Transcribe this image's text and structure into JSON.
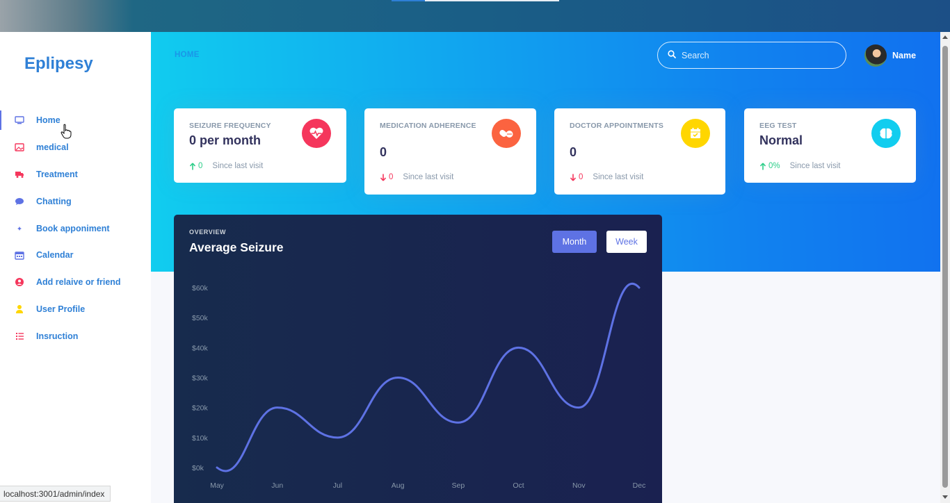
{
  "sidebar": {
    "brand": "Eplipesy",
    "items": [
      {
        "label": "Home",
        "icon": "monitor-icon",
        "color": "#5e72e4"
      },
      {
        "label": "medical",
        "icon": "image-icon",
        "color": "#f5365c"
      },
      {
        "label": "Treatment",
        "icon": "truck-icon",
        "color": "#f5365c"
      },
      {
        "label": "Chatting",
        "icon": "chat-bubble-icon",
        "color": "#5e72e4"
      },
      {
        "label": "Book apponiment",
        "icon": "sparkle-icon",
        "color": "#5e72e4"
      },
      {
        "label": "Calendar",
        "icon": "calendar-icon",
        "color": "#5e72e4"
      },
      {
        "label": "Add relaive or friend",
        "icon": "user-circle-icon",
        "color": "#f5365c"
      },
      {
        "label": "User Profile",
        "icon": "user-icon",
        "color": "#ffd600"
      },
      {
        "label": "Insruction",
        "icon": "list-icon",
        "color": "#f5365c"
      }
    ]
  },
  "header": {
    "breadcrumb": "HOME",
    "search_placeholder": "Search",
    "user_name": "Name"
  },
  "cards": [
    {
      "title": "Seizure frequency",
      "value": "0 per month",
      "delta": "0",
      "direction": "up",
      "since": "Since last visit",
      "icon": "heart-pulse-icon",
      "icon_color": "#f5365c"
    },
    {
      "title": "Medication adherence",
      "value": "0",
      "delta": "0",
      "direction": "down",
      "since": "Since last visit",
      "icon": "pills-icon",
      "icon_color": "#fb6340"
    },
    {
      "title": "Doctor appointments",
      "value": "0",
      "delta": "0",
      "direction": "down",
      "since": "Since last visit",
      "icon": "calendar-check-icon",
      "icon_color": "#ffd600"
    },
    {
      "title": "EEG test",
      "value": "Normal",
      "delta": "0%",
      "direction": "up",
      "since": "Since last visit",
      "icon": "brain-icon",
      "icon_color": "#11cdef"
    }
  ],
  "overview": {
    "label": "OVERVIEW",
    "title": "Average Seizure",
    "tab_month": "Month",
    "tab_week": "Week"
  },
  "chart_data": {
    "type": "line",
    "categories": [
      "May",
      "Jun",
      "Jul",
      "Aug",
      "Sep",
      "Oct",
      "Nov",
      "Dec"
    ],
    "values": [
      0,
      20,
      10,
      30,
      15,
      40,
      20,
      60
    ],
    "yticks": [
      "$0k",
      "$10k",
      "$20k",
      "$30k",
      "$40k",
      "$50k",
      "$60k"
    ],
    "ylim": [
      0,
      60
    ],
    "line_color": "#5e72e4"
  },
  "status_bar": "localhost:3001/admin/index"
}
